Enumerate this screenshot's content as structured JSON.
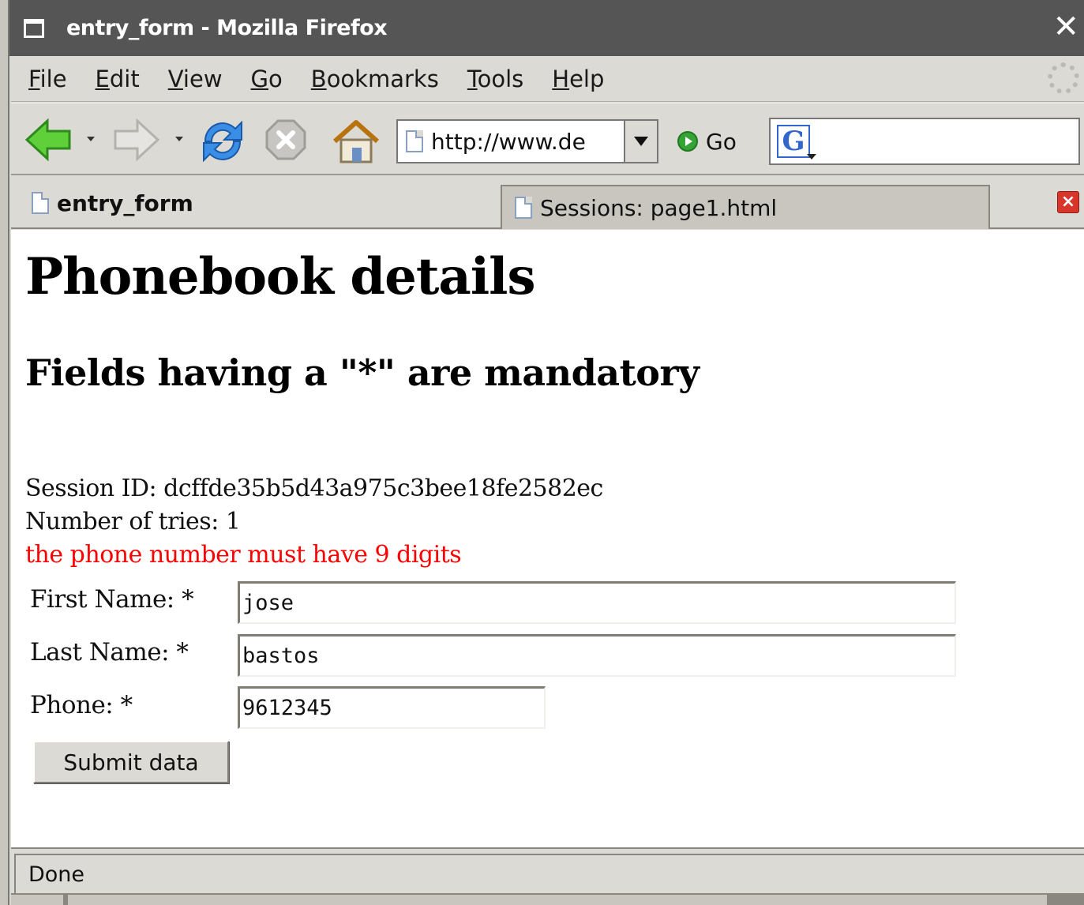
{
  "window": {
    "title": "entry_form - Mozilla Firefox",
    "close_glyph": "✕"
  },
  "menubar": {
    "items": [
      {
        "accel": "F",
        "rest": "ile"
      },
      {
        "accel": "E",
        "rest": "dit"
      },
      {
        "accel": "V",
        "rest": "iew"
      },
      {
        "accel": "G",
        "rest": "o"
      },
      {
        "accel": "B",
        "rest": "ookmarks"
      },
      {
        "accel": "T",
        "rest": "ools"
      },
      {
        "accel": "H",
        "rest": "elp"
      }
    ]
  },
  "toolbar": {
    "url": "http://www.de",
    "go_label": "Go",
    "search_logo": "G"
  },
  "tabs": [
    {
      "label": "entry_form",
      "active": true
    },
    {
      "label": "Sessions: page1.html",
      "active": false
    }
  ],
  "page": {
    "heading": "Phonebook details",
    "subheading": "Fields having a \"*\" are mandatory",
    "session_line": "Session ID: dcffde35b5d43a975c3bee18fe2582ec",
    "tries_line": "Number of tries: 1",
    "error_line": "the phone number must have 9 digits",
    "form": {
      "first_name_label": "First Name: *",
      "first_name_value": "jose",
      "last_name_label": "Last Name: *",
      "last_name_value": "bastos",
      "phone_label": "Phone: *",
      "phone_value": "9612345",
      "submit_label": "Submit data"
    },
    "error_color": "#ff0000"
  },
  "status": {
    "text": "Done"
  },
  "icons": [
    "window-menu-icon",
    "close-icon",
    "throbber-icon",
    "back-icon",
    "forward-icon",
    "reload-icon",
    "stop-icon",
    "home-icon",
    "page-icon",
    "url-dropdown-icon",
    "go-icon",
    "google-search-icon",
    "tab-close-icon"
  ]
}
